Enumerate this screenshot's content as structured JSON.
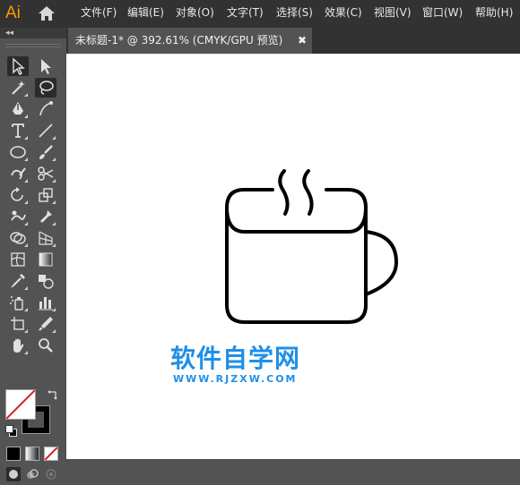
{
  "app": {
    "logo": "Ai"
  },
  "menu": [
    "文件(F)",
    "编辑(E)",
    "对象(O)",
    "文字(T)",
    "选择(S)",
    "效果(C)",
    "视图(V)",
    "窗口(W)",
    "帮助(H)"
  ],
  "toolbar": {
    "collapse": "◂◂"
  },
  "document_tab": {
    "title": "未标题-1* @ 392.61% (CMYK/GPU 预览)",
    "close": "✖"
  },
  "canvas": {
    "artwork": "mug-icon"
  },
  "watermark": {
    "title": "软件自学网",
    "url": "WWW.RJZXW.COM"
  },
  "colors": {
    "accent": "#FF9A00",
    "watermark": "#1f8fe8",
    "canvas": "#ffffff",
    "chrome": "#323232",
    "panel": "#535353"
  }
}
